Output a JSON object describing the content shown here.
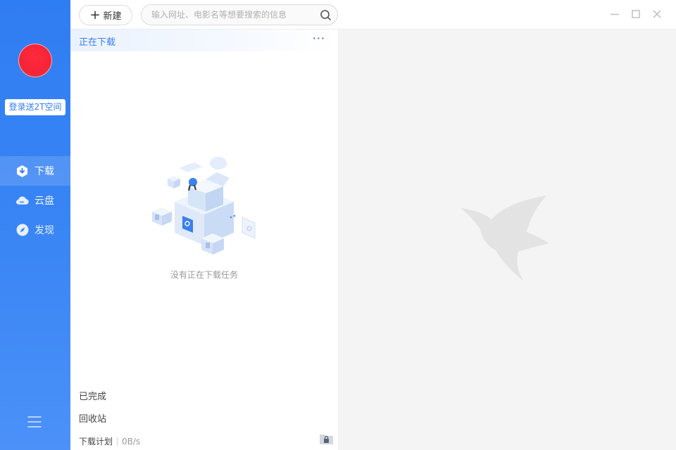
{
  "sidebar": {
    "login_badge": "登录送2T空间",
    "nav": [
      {
        "label": "下载",
        "icon": "download-shield-icon",
        "active": true
      },
      {
        "label": "云盘",
        "icon": "cloud-icon",
        "active": false
      },
      {
        "label": "发现",
        "icon": "compass-icon",
        "active": false
      }
    ],
    "menu_icon": "hamburger-menu-icon"
  },
  "topbar": {
    "new_label": "新建",
    "search_placeholder": "输入网址、电影名等想要搜索的信息",
    "search_value": ""
  },
  "downloads": {
    "section_title": "正在下载",
    "more_label": "···",
    "empty_text": "没有正在下载任务",
    "completed_label": "已完成",
    "recycle_label": "回收站",
    "plan_label": "下载计划",
    "speed": "0B/s"
  },
  "colors": {
    "accent": "#2f7df2",
    "section_title": "#3a7fee",
    "detail_bg": "#f4f4f4",
    "watermark": "#e3e3e3"
  }
}
